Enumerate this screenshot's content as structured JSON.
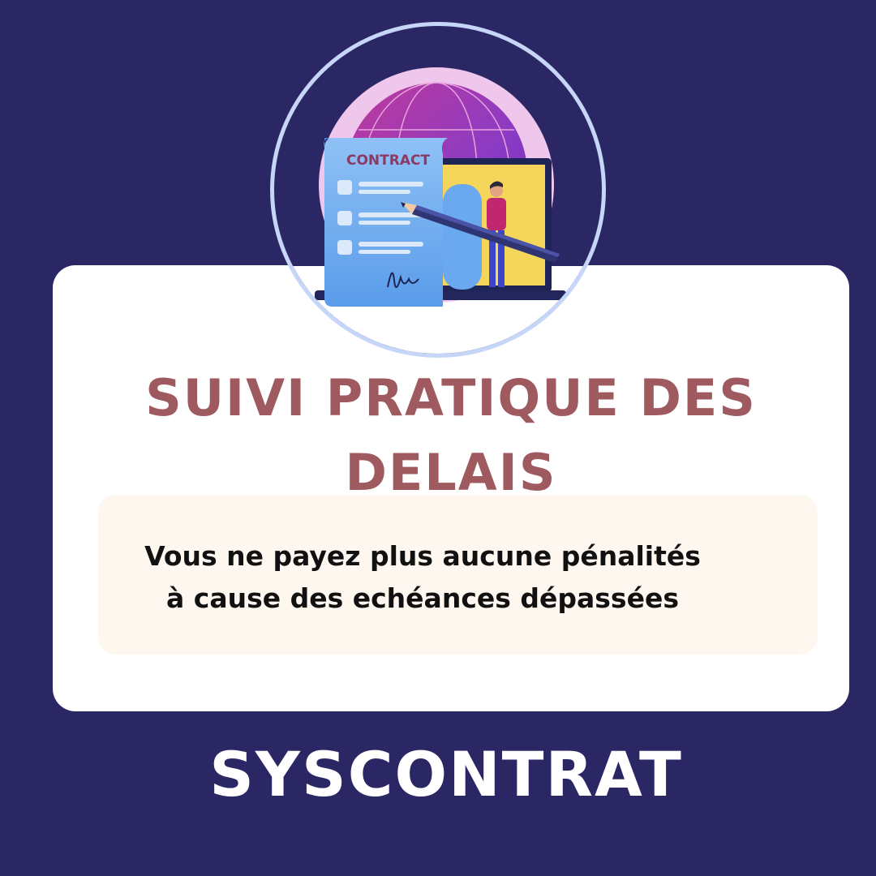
{
  "illustration": {
    "document_label": "CONTRACT",
    "icon": "contract-signing-illustration"
  },
  "heading": {
    "line1": "SUIVI PRATIQUE DES",
    "line2": "DELAIS"
  },
  "subtitle": {
    "line1": "Vous ne payez plus aucune pénalités",
    "line2": "à cause des echéances dépassées"
  },
  "brand": "SYSCONTRAT",
  "colors": {
    "background": "#2b2765",
    "card": "#ffffff",
    "heading": "#9e5a5e",
    "subtitle_box": "#fdf7f0",
    "ring": "#c6d6f8"
  }
}
